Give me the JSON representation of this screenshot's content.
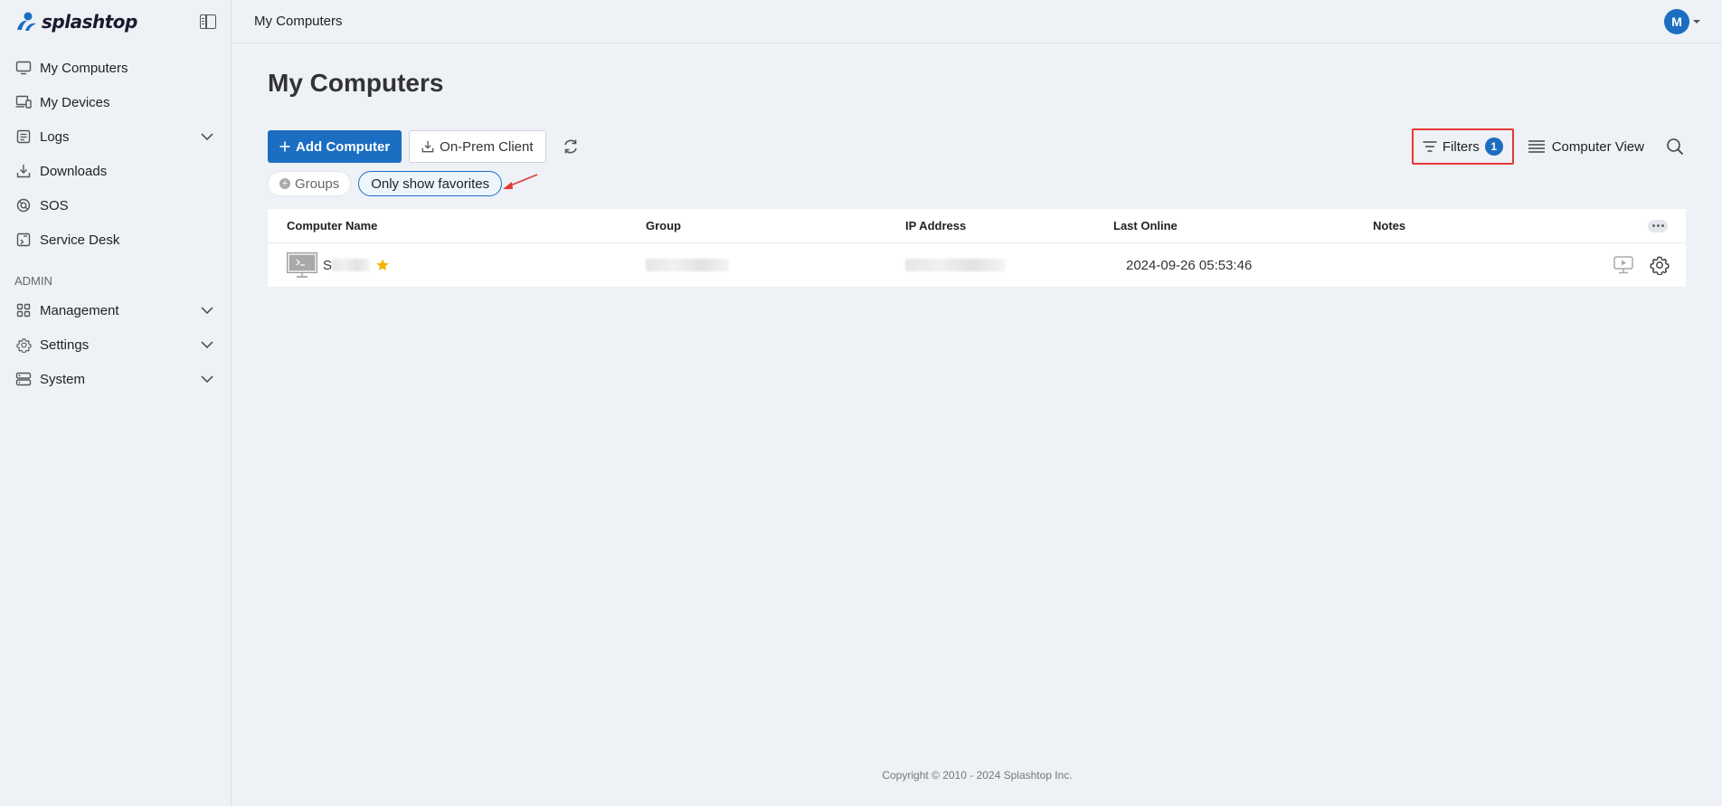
{
  "brand": {
    "name": "splashtop",
    "accent": "#1b6ec2"
  },
  "sidebar": {
    "items": [
      {
        "label": "My Computers",
        "icon": "monitor-icon"
      },
      {
        "label": "My Devices",
        "icon": "devices-icon"
      },
      {
        "label": "Logs",
        "icon": "logs-icon",
        "expandable": true
      },
      {
        "label": "Downloads",
        "icon": "download-icon"
      },
      {
        "label": "SOS",
        "icon": "sos-icon"
      },
      {
        "label": "Service Desk",
        "icon": "service-desk-icon"
      }
    ],
    "admin_label": "ADMIN",
    "admin_items": [
      {
        "label": "Management",
        "icon": "grid-icon",
        "expandable": true
      },
      {
        "label": "Settings",
        "icon": "gear-icon",
        "expandable": true
      },
      {
        "label": "System",
        "icon": "server-icon",
        "expandable": true
      }
    ]
  },
  "header": {
    "breadcrumb": "My Computers",
    "avatar_initial": "M"
  },
  "main": {
    "title": "My Computers",
    "add_computer_label": "Add Computer",
    "onprem_label": "On-Prem Client",
    "filters_label": "Filters",
    "filters_count": "1",
    "view_label": "Computer View",
    "chips": {
      "groups": "Groups",
      "favorites": "Only show favorites"
    }
  },
  "table": {
    "columns": [
      "Computer Name",
      "Group",
      "IP Address",
      "Last Online",
      "Notes"
    ],
    "rows": [
      {
        "name": "S",
        "group": "",
        "ip": "",
        "last_online": "2024-09-26 05:53:46",
        "notes": "",
        "favorite": true
      }
    ]
  },
  "footer": {
    "copyright": "Copyright © 2010 - 2024 Splashtop Inc."
  }
}
